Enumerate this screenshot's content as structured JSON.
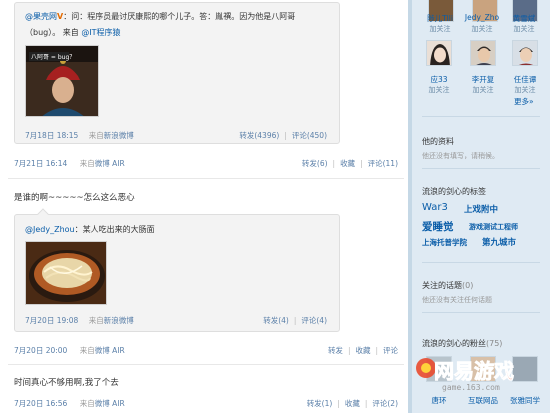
{
  "feed": {
    "post1": {
      "quote_user": "@果壳网",
      "quote_text_1": "：问：程序员最讨厌康熙的哪个儿子。答：胤禩。因为他是八阿哥",
      "quote_text_2": "（bug）。 来自 ",
      "quote_source_user": "@IT程序猿",
      "image_caption": "八阿哥 = bug？",
      "quote_date": "7月18日 18:15",
      "quote_via_prefix": "来自",
      "quote_via": "新浪微博",
      "quote_repost": "转发(4396)",
      "quote_comment": "评论(450)",
      "date": "7月21日 16:14",
      "via_prefix": "来自",
      "via": "微博 AIR",
      "repost": "转发(6)",
      "favorite": "收藏",
      "comment": "评论(11)"
    },
    "post2": {
      "text": "是谁的啊~~~~~怎么这么恶心",
      "quote_user": "@Jedy_Zhou",
      "quote_text": "：某人吃出来的大肠面",
      "quote_date": "7月20日 19:08",
      "quote_via_prefix": "来自",
      "quote_via": "新浪微博",
      "quote_repost": "转发(4)",
      "quote_comment": "评论(4)",
      "date": "7月20日 20:00",
      "via_prefix": "来自",
      "via": "微博 AIR",
      "repost": "转发",
      "favorite": "收藏",
      "comment": "评论"
    },
    "post3": {
      "text": "时间真心不够用啊,我了个去",
      "date": "7月20日 16:56",
      "via_prefix": "来自",
      "via": "微博 AIR",
      "repost": "转发(1)",
      "favorite": "收藏",
      "comment": "评论(2)"
    },
    "separator": "|"
  },
  "sidebar": {
    "friends": [
      {
        "name": "陟儿Tlli",
        "action": "加关注"
      },
      {
        "name": "Jedy_Zho",
        "action": "加关注"
      },
      {
        "name": "黄雪斌",
        "action": "加关注"
      },
      {
        "name": "应33",
        "action": "加关注"
      },
      {
        "name": "李开复",
        "action": "加关注"
      },
      {
        "name": "任佳谭",
        "action": "加关注"
      }
    ],
    "more": "更多»",
    "profile_title": "他的资料",
    "profile_sub": "他还没有填写，请稍候。",
    "tags_title": "流浪的剑心的标签",
    "tags": [
      "War3",
      "上戏附中",
      "爱睡觉",
      "游戏测试工程师",
      "上海托普学院",
      "第九城市"
    ],
    "topics_title": "关注的话题",
    "topics_count": "(0)",
    "topics_sub": "他还没有关注任何话题",
    "fans_title": "流浪的剑心的粉丝",
    "fans_count": "(75)",
    "fans": [
      "唐环",
      "互联网品",
      "张雅同学"
    ],
    "watermark_title": "网易游戏",
    "watermark_url": "game.163.com"
  },
  "colors": {
    "link": "#0a5da8",
    "sidebar_bg": "#dfeaf3",
    "quote_bg": "#f3f3f3"
  }
}
